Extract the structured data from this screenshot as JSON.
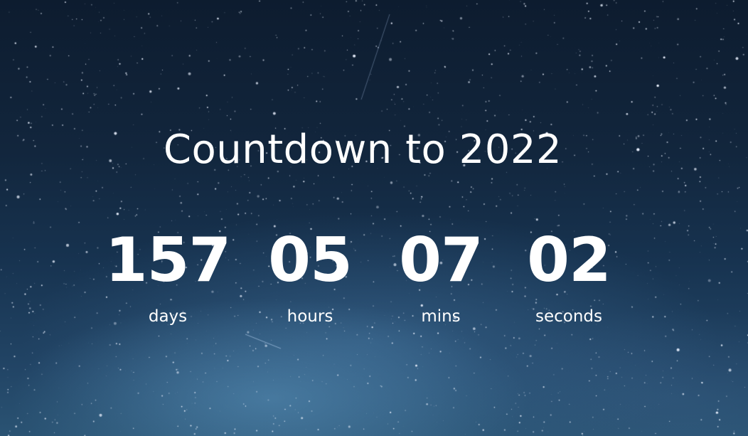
{
  "title": "Countdown to 2022",
  "countdown": [
    {
      "value": "157",
      "label": "days"
    },
    {
      "value": "05",
      "label": "hours"
    },
    {
      "value": "07",
      "label": "mins"
    },
    {
      "value": "02",
      "label": "seconds"
    }
  ],
  "colors": {
    "text": "#ffffff",
    "sky_top": "#0d1c2f",
    "sky_bottom": "#2a5373"
  },
  "background": "starry-night-sky"
}
